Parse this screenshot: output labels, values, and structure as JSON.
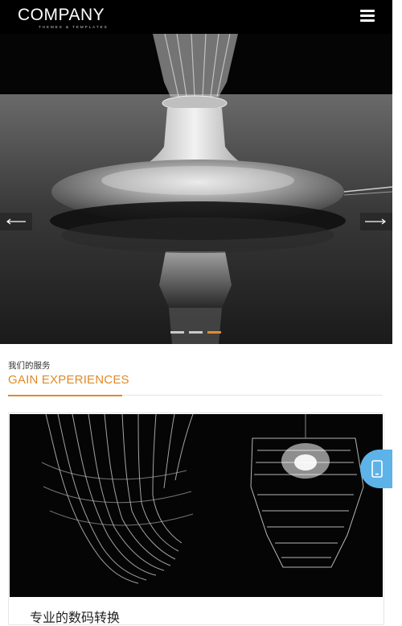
{
  "header": {
    "logo_main": "COMPANY",
    "logo_sub": "THEMES & TEMPLATES",
    "menu_icon": "hamburger-menu-icon"
  },
  "hero": {
    "image_subject": "glass vase base on reflective table",
    "prev_icon": "arrow-left-icon",
    "next_icon": "arrow-right-icon",
    "slides": 3,
    "active_slide": 3
  },
  "section": {
    "subtitle": "我们的服务",
    "title": "GAIN EXPERIENCES"
  },
  "card": {
    "image_subject": "crystal chandeliers",
    "title": "专业的数码转换"
  },
  "float": {
    "icon": "mobile-phone-icon"
  },
  "colors": {
    "accent": "#e08a28",
    "float_button": "#5db3e8",
    "header_bg": "#000000"
  }
}
